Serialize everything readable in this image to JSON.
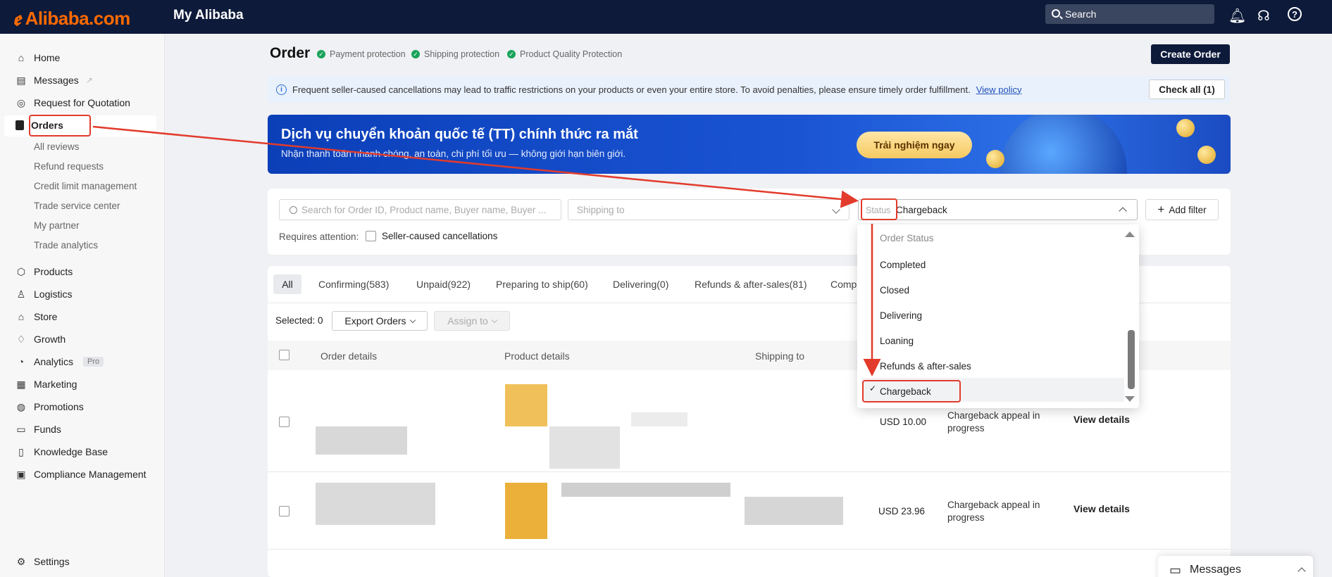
{
  "topbar": {
    "brand": "Alibaba.com",
    "section": "My Alibaba",
    "search_placeholder": "Search"
  },
  "sidebar": {
    "items": [
      {
        "label": "Home",
        "icon": "home-icon"
      },
      {
        "label": "Messages",
        "icon": "message-icon"
      },
      {
        "label": "Request for Quotation",
        "icon": "rfq-icon"
      },
      {
        "label": "Orders",
        "icon": "orders-icon"
      },
      {
        "label": "Products",
        "icon": "box-icon"
      },
      {
        "label": "Logistics",
        "icon": "logistics-icon"
      },
      {
        "label": "Store",
        "icon": "store-icon"
      },
      {
        "label": "Growth",
        "icon": "growth-icon"
      },
      {
        "label": "Analytics",
        "icon": "analytics-icon",
        "badge": "Pro"
      },
      {
        "label": "Marketing",
        "icon": "marketing-icon"
      },
      {
        "label": "Promotions",
        "icon": "promotions-icon"
      },
      {
        "label": "Funds",
        "icon": "funds-icon"
      },
      {
        "label": "Knowledge Base",
        "icon": "book-icon"
      },
      {
        "label": "Compliance Management",
        "icon": "compliance-icon"
      }
    ],
    "sub_items": [
      "All reviews",
      "Refund requests",
      "Credit limit management",
      "Trade service center",
      "My partner",
      "Trade analytics"
    ],
    "settings": "Settings"
  },
  "page": {
    "title": "Order",
    "protections": [
      "Payment protection",
      "Shipping protection",
      "Product Quality Protection"
    ],
    "create_button": "Create Order"
  },
  "notice": {
    "text": "Frequent seller-caused cancellations may lead to traffic restrictions on your products or even your entire store. To avoid penalties, please ensure timely order fulfillment.",
    "link": "View policy",
    "check_all": "Check all (1)"
  },
  "banner": {
    "title": "Dịch vụ chuyển khoản quốc tế (TT) chính thức ra mắt",
    "subtitle": "Nhận thanh toán nhanh chóng, an toàn, chi phí tối ưu — không giới hạn biên giới.",
    "button": "Trải nghiệm ngay"
  },
  "filters": {
    "search_placeholder": "Search for Order ID, Product name, Buyer name, Buyer ...",
    "shipping_placeholder": "Shipping to",
    "status_label": "Status",
    "status_value": "Chargeback",
    "add_filter": "Add filter",
    "requires_attention": "Requires attention:",
    "seller_cancellations": "Seller-caused cancellations"
  },
  "tabs": [
    "All",
    "Confirming(583)",
    "Unpaid(922)",
    "Preparing to ship(60)",
    "Delivering(0)",
    "Refunds & after-sales(81)",
    "Comp"
  ],
  "toolbar": {
    "selected": "Selected: 0",
    "export": "Export Orders",
    "assign": "Assign to"
  },
  "table": {
    "headers": [
      "Order details",
      "Product details",
      "Shipping to"
    ],
    "rows": [
      {
        "amount": "USD 10.00",
        "status": "Chargeback appeal in progress",
        "action": "View details"
      },
      {
        "amount": "USD 23.96",
        "status": "Chargeback appeal in progress",
        "action": "View details"
      }
    ]
  },
  "dropdown": {
    "group": "Order Status",
    "options": [
      "Completed",
      "Closed",
      "Delivering",
      "Loaning",
      "Refunds & after-sales",
      "Chargeback"
    ],
    "selected": "Chargeback"
  },
  "messages_bar": "Messages",
  "colors": {
    "topbar": "#0d1a3a",
    "brand_orange": "#ff6a00",
    "annotation_red": "#e23b2c"
  }
}
